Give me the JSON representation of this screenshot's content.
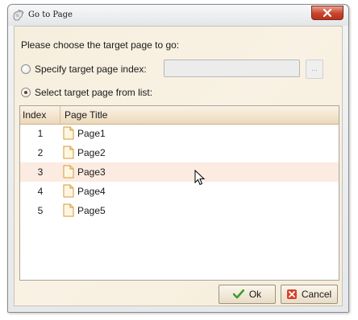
{
  "window": {
    "title": "Go to Page",
    "icon": "page-hand-icon",
    "close_icon": "close-icon"
  },
  "prompt": "Please choose the target page to go:",
  "options": {
    "specify": {
      "label": "Specify target page index:",
      "checked": false
    },
    "select": {
      "label": "Select target page from list:",
      "checked": true
    }
  },
  "index_input": {
    "value": "",
    "enabled": false
  },
  "browse_button": {
    "label": "..."
  },
  "table": {
    "columns": [
      "Index",
      "Page Title"
    ],
    "rows": [
      {
        "index": "1",
        "title": "Page1"
      },
      {
        "index": "2",
        "title": "Page2"
      },
      {
        "index": "3",
        "title": "Page3",
        "hovered": true
      },
      {
        "index": "4",
        "title": "Page4"
      },
      {
        "index": "5",
        "title": "Page5"
      }
    ]
  },
  "buttons": {
    "ok": {
      "label": "Ok",
      "icon": "check-icon"
    },
    "cancel": {
      "label": "Cancel",
      "icon": "x-icon"
    }
  },
  "colors": {
    "client_bg": "#f8f0e0",
    "header_bg": "#ecd8ba",
    "row_hover": "#fcebe0",
    "close_red": "#c7432b"
  }
}
